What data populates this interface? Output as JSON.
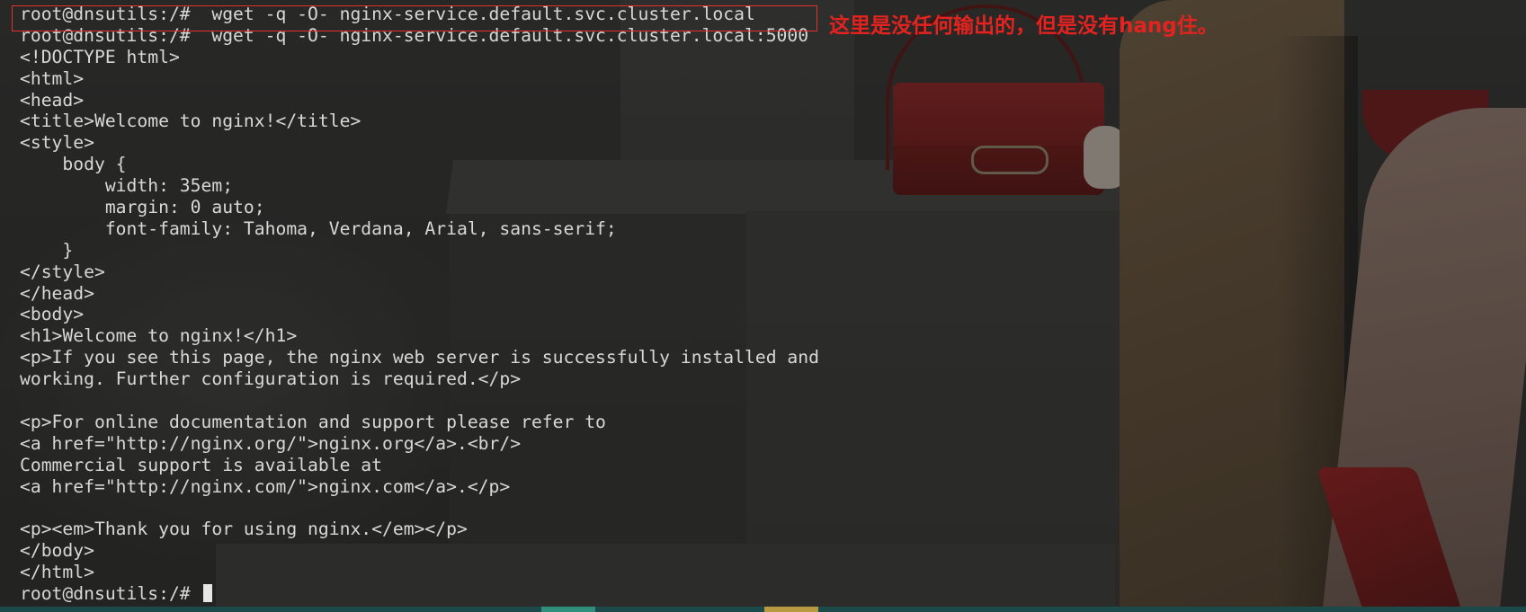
{
  "terminal": {
    "lines": [
      "root@dnsutils:/#  wget -q -O- nginx-service.default.svc.cluster.local",
      "root@dnsutils:/#  wget -q -O- nginx-service.default.svc.cluster.local:5000",
      "<!DOCTYPE html>",
      "<html>",
      "<head>",
      "<title>Welcome to nginx!</title>",
      "<style>",
      "    body {",
      "        width: 35em;",
      "        margin: 0 auto;",
      "        font-family: Tahoma, Verdana, Arial, sans-serif;",
      "    }",
      "</style>",
      "</head>",
      "<body>",
      "<h1>Welcome to nginx!</h1>",
      "<p>If you see this page, the nginx web server is successfully installed and",
      "working. Further configuration is required.</p>",
      "",
      "<p>For online documentation and support please refer to",
      "<a href=\"http://nginx.org/\">nginx.org</a>.<br/>",
      "Commercial support is available at",
      "<a href=\"http://nginx.com/\">nginx.com</a>.</p>",
      "",
      "<p><em>Thank you for using nginx.</em></p>",
      "</body>",
      "</html>"
    ],
    "prompt": "root@dnsutils:/# "
  },
  "annotation": {
    "text": "这里是没任何输出的，但是没有hang住。",
    "color": "#e2231f"
  },
  "colors": {
    "terminal_text": "#d8d8d8",
    "highlight_box": "#e03030"
  }
}
